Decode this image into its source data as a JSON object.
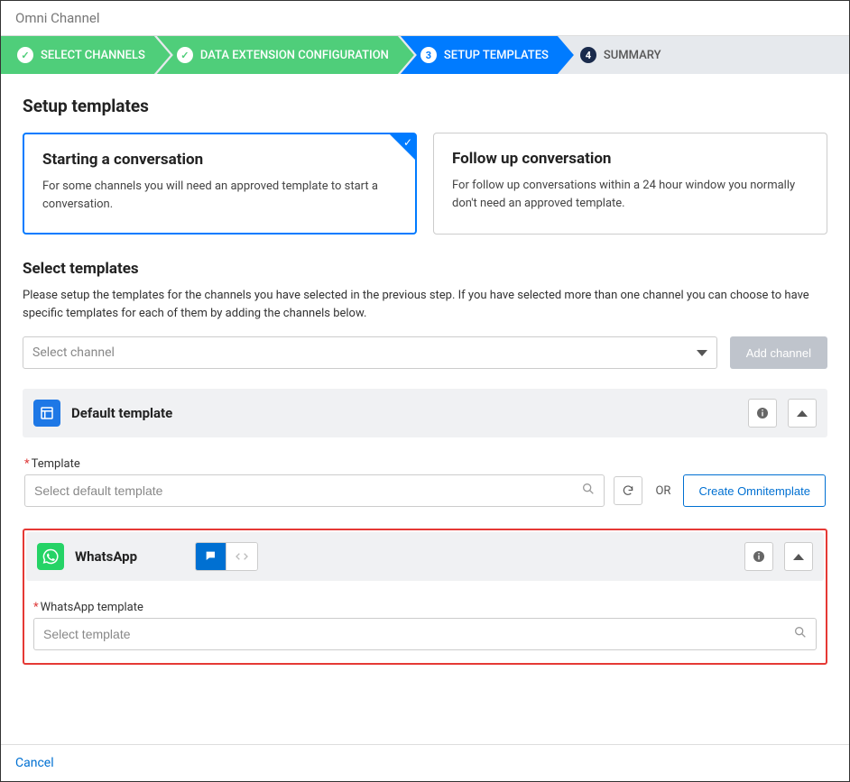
{
  "window_title": "Omni Channel",
  "stepper": {
    "steps": [
      {
        "label": "SELECT CHANNELS",
        "state": "done"
      },
      {
        "label": "DATA EXTENSION CONFIGURATION",
        "state": "done"
      },
      {
        "label": "SETUP TEMPLATES",
        "state": "active",
        "num": "3"
      },
      {
        "label": "SUMMARY",
        "state": "pending",
        "num": "4"
      }
    ]
  },
  "page": {
    "heading": "Setup templates",
    "cards": {
      "start": {
        "title": "Starting a conversation",
        "desc": "For some channels you will need an approved template to start a conversation."
      },
      "followup": {
        "title": "Follow up conversation",
        "desc": "For follow up conversations within a 24 hour window you normally don't need an approved template."
      }
    },
    "select_section": {
      "heading": "Select templates",
      "desc": "Please setup the templates for the channels you have selected in the previous step. If you have selected more than one channel you can choose to have specific templates for each of them by adding the channels below.",
      "channel_placeholder": "Select channel",
      "add_channel_label": "Add channel"
    },
    "default_panel": {
      "title": "Default template",
      "field_label": "Template",
      "placeholder": "Select default template",
      "or_text": "OR",
      "create_label": "Create Omnitemplate"
    },
    "whatsapp_panel": {
      "title": "WhatsApp",
      "field_label": "WhatsApp template",
      "placeholder": "Select template"
    }
  },
  "footer": {
    "cancel": "Cancel"
  }
}
